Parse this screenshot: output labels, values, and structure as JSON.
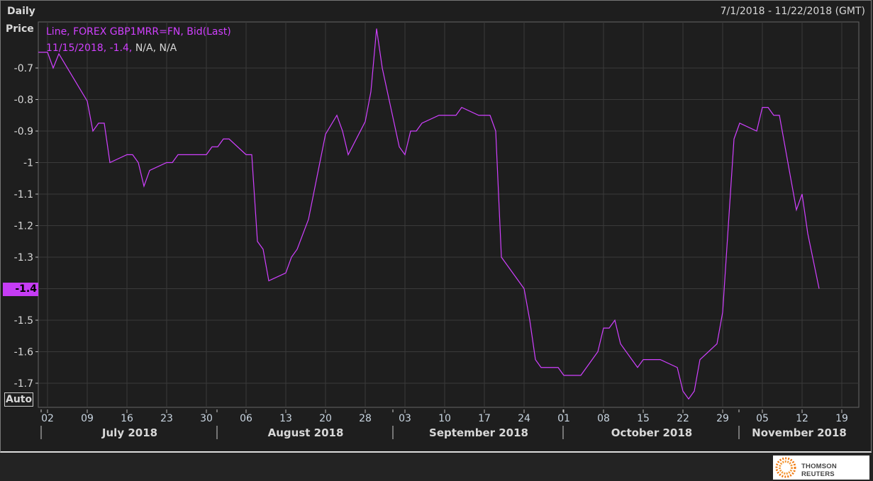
{
  "header": {
    "title_line1": "Daily",
    "title_line2": "Price",
    "date_range": "7/1/2018 - 11/22/2018 (GMT)"
  },
  "legend": {
    "series": "Line, FOREX GBP1MRR=FN, Bid(Last)",
    "readout_date_value": "11/15/2018, -1.4,",
    "readout_na": "N/A, N/A"
  },
  "auto_button": "Auto",
  "last_value_label": "-1.4",
  "logo_text": "THOMSON REUTERS",
  "colors": {
    "line": "#d040ff",
    "highlight": "#c63cf5"
  },
  "chart_data": {
    "type": "line",
    "title": "Daily Price",
    "series_name": "FOREX GBP1MRR=FN, Bid(Last)",
    "x_unit": "days since 2018-07-01",
    "xlim": [
      -0.6,
      144
    ],
    "ylim": [
      -1.82,
      -0.6
    ],
    "y_ticks": [
      -0.7,
      -0.8,
      -0.9,
      -1,
      -1.1,
      -1.2,
      -1.3,
      -1.4,
      -1.5,
      -1.6,
      -1.7
    ],
    "y_tick_labels": [
      "-0.7",
      "-0.8",
      "-0.9",
      "-1",
      "-1.1",
      "-1.2",
      "-1.3",
      "-1.4",
      "-1.5",
      "-1.6",
      "-1.7"
    ],
    "x_ticks": [
      1,
      8,
      15,
      22,
      29,
      36,
      43,
      50,
      57,
      64,
      71,
      78,
      85,
      92,
      99,
      106,
      113,
      120,
      127,
      134,
      141
    ],
    "x_tick_labels": [
      "02",
      "09",
      "16",
      "23",
      "30",
      "06",
      "13",
      "20",
      "28",
      "03",
      "10",
      "17",
      "24",
      "01",
      "08",
      "15",
      "22",
      "29",
      "05",
      "12",
      "19"
    ],
    "months": [
      {
        "label": "July 2018",
        "start": 0,
        "end": 31
      },
      {
        "label": "August 2018",
        "start": 31,
        "end": 62
      },
      {
        "label": "September 2018",
        "start": 62,
        "end": 92
      },
      {
        "label": "October 2018",
        "start": 92,
        "end": 123
      },
      {
        "label": "November 2018",
        "start": 123,
        "end": 144
      }
    ],
    "grid": true,
    "points": [
      [
        -0.6,
        -0.65
      ],
      [
        1,
        -0.65
      ],
      [
        2,
        -0.7
      ],
      [
        3,
        -0.655
      ],
      [
        4,
        -0.685
      ],
      [
        8,
        -0.805
      ],
      [
        9,
        -0.9
      ],
      [
        10,
        -0.875
      ],
      [
        11,
        -0.875
      ],
      [
        12,
        -1.0
      ],
      [
        15,
        -0.975
      ],
      [
        16,
        -0.975
      ],
      [
        17,
        -1.0
      ],
      [
        18,
        -1.075
      ],
      [
        19,
        -1.025
      ],
      [
        22,
        -1.0
      ],
      [
        23,
        -1.0
      ],
      [
        24,
        -0.975
      ],
      [
        29,
        -0.975
      ],
      [
        30,
        -0.95
      ],
      [
        31,
        -0.95
      ],
      [
        32,
        -0.925
      ],
      [
        33,
        -0.925
      ],
      [
        36,
        -0.975
      ],
      [
        37,
        -0.975
      ],
      [
        38,
        -1.25
      ],
      [
        39,
        -1.275
      ],
      [
        40,
        -1.375
      ],
      [
        43,
        -1.35
      ],
      [
        44,
        -1.3
      ],
      [
        45,
        -1.275
      ],
      [
        47,
        -1.18
      ],
      [
        50,
        -0.91
      ],
      [
        52,
        -0.85
      ],
      [
        53,
        -0.9
      ],
      [
        54,
        -0.975
      ],
      [
        57,
        -0.87
      ],
      [
        58,
        -0.775
      ],
      [
        59,
        -0.575
      ],
      [
        60,
        -0.7
      ],
      [
        63,
        -0.95
      ],
      [
        64,
        -0.975
      ],
      [
        65,
        -0.9
      ],
      [
        66,
        -0.9
      ],
      [
        67,
        -0.875
      ],
      [
        70,
        -0.85
      ],
      [
        73,
        -0.85
      ],
      [
        74,
        -0.825
      ],
      [
        77,
        -0.85
      ],
      [
        79,
        -0.85
      ],
      [
        80,
        -0.9
      ],
      [
        81,
        -1.3
      ],
      [
        85,
        -1.4
      ],
      [
        86,
        -1.5
      ],
      [
        87,
        -1.625
      ],
      [
        88,
        -1.65
      ],
      [
        91,
        -1.65
      ],
      [
        92,
        -1.675
      ],
      [
        95,
        -1.675
      ],
      [
        96,
        -1.65
      ],
      [
        98,
        -1.6
      ],
      [
        99,
        -1.525
      ],
      [
        100,
        -1.525
      ],
      [
        101,
        -1.5
      ],
      [
        102,
        -1.575
      ],
      [
        105,
        -1.65
      ],
      [
        106,
        -1.625
      ],
      [
        109,
        -1.625
      ],
      [
        112,
        -1.65
      ],
      [
        113,
        -1.725
      ],
      [
        114,
        -1.75
      ],
      [
        115,
        -1.725
      ],
      [
        116,
        -1.625
      ],
      [
        119,
        -1.575
      ],
      [
        120,
        -1.475
      ],
      [
        121,
        -1.2
      ],
      [
        122,
        -0.925
      ],
      [
        123,
        -0.875
      ],
      [
        126,
        -0.9
      ],
      [
        127,
        -0.825
      ],
      [
        128,
        -0.825
      ],
      [
        129,
        -0.85
      ],
      [
        130,
        -0.85
      ],
      [
        133,
        -1.15
      ],
      [
        134,
        -1.1
      ],
      [
        135,
        -1.225
      ],
      [
        137,
        -1.4
      ]
    ]
  }
}
